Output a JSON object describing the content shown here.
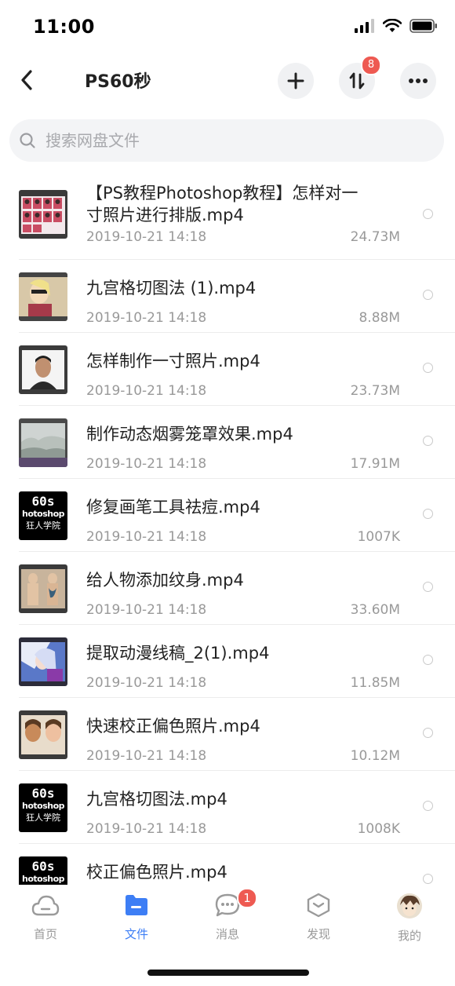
{
  "status_bar": {
    "time": "11:00"
  },
  "header": {
    "title": "PS60秒",
    "transfer_badge": "8"
  },
  "search": {
    "placeholder": "搜索网盘文件"
  },
  "files": [
    {
      "name": "【PS教程Photoshop教程】怎样对一寸照片进行排版.mp4",
      "date": "2019-10-21 14:18",
      "size": "24.73M"
    },
    {
      "name": "九宫格切图法 (1).mp4",
      "date": "2019-10-21 14:18",
      "size": "8.88M"
    },
    {
      "name": "怎样制作一寸照片.mp4",
      "date": "2019-10-21 14:18",
      "size": "23.73M"
    },
    {
      "name": "制作动态烟雾笼罩效果.mp4",
      "date": "2019-10-21 14:18",
      "size": "17.91M"
    },
    {
      "name": "修复画笔工具祛痘.mp4",
      "date": "2019-10-21 14:18",
      "size": "1007K"
    },
    {
      "name": "给人物添加纹身.mp4",
      "date": "2019-10-21 14:18",
      "size": "33.60M"
    },
    {
      "name": "提取动漫线稿_2(1).mp4",
      "date": "2019-10-21 14:18",
      "size": "11.85M"
    },
    {
      "name": "快速校正偏色照片.mp4",
      "date": "2019-10-21 14:18",
      "size": "10.12M"
    },
    {
      "name": "九宫格切图法.mp4",
      "date": "2019-10-21 14:18",
      "size": "1008K"
    },
    {
      "name": "校正偏色照片.mp4",
      "date": "",
      "size": ""
    }
  ],
  "thumb_text": {
    "line1": "60s",
    "line2": "hotoshop",
    "line3": "狂人学院"
  },
  "tabs": [
    {
      "label": "首页"
    },
    {
      "label": "文件"
    },
    {
      "label": "消息",
      "badge": "1"
    },
    {
      "label": "发现"
    },
    {
      "label": "我的"
    }
  ],
  "colors": {
    "accent": "#3d7ef5",
    "badge": "#ee5a52"
  }
}
